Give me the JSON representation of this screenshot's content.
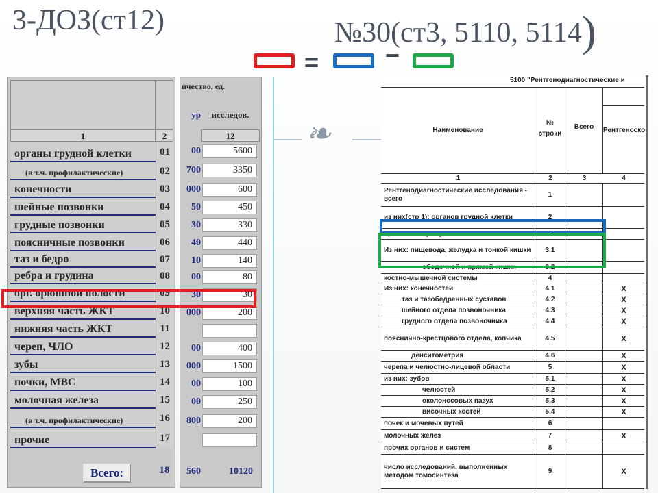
{
  "title": {
    "left": "3-ДОЗ(ст12)",
    "right": "№30(ст3, 5110, 5114",
    "right_paren": ")"
  },
  "legend": {
    "equals": "=",
    "minus": "−"
  },
  "divider_glyph": "❧",
  "colors": {
    "red": "#e02020",
    "blue": "#1a6bc0",
    "green": "#1ea84a"
  },
  "left_table": {
    "col1_header": "1",
    "col2_header": "2",
    "rows": [
      {
        "name": "органы грудной клетки",
        "code": "01",
        "small": false
      },
      {
        "name": "(в т.ч. профилактические)",
        "code": "02",
        "small": true
      },
      {
        "name": "конечности",
        "code": "03",
        "small": false
      },
      {
        "name": "шейные позвонки",
        "code": "04",
        "small": false
      },
      {
        "name": "грудные позвонки",
        "code": "05",
        "small": false
      },
      {
        "name": "поясничные позвонки",
        "code": "06",
        "small": false
      },
      {
        "name": "таз и бедро",
        "code": "07",
        "small": false
      },
      {
        "name": "ребра и грудина",
        "code": "08",
        "small": false
      },
      {
        "name": "орг. орюшной полости",
        "code": "09",
        "small": false
      },
      {
        "name": "верхняя часть ЖКТ",
        "code": "10",
        "small": false
      },
      {
        "name": "нижняя часть ЖКТ",
        "code": "11",
        "small": false
      },
      {
        "name": "череп, ЧЛО",
        "code": "12",
        "small": false
      },
      {
        "name": "зубы",
        "code": "13",
        "small": false
      },
      {
        "name": "почки, МВС",
        "code": "14",
        "small": false
      },
      {
        "name": "молочная железа",
        "code": "15",
        "small": false
      },
      {
        "name": "(в т.ч. профилактические)",
        "code": "16",
        "small": true
      },
      {
        "name": "прочие",
        "code": "17",
        "small": false
      }
    ],
    "total_label": "Всего:",
    "total_code": "18"
  },
  "mid_table": {
    "header_text": "ичество, ед.",
    "col_left_header": "ур",
    "col_right_header": "исследов.",
    "col_number": "12",
    "rows": [
      {
        "left": "00",
        "value": "5600"
      },
      {
        "left": "700",
        "value": "3350"
      },
      {
        "left": "000",
        "value": "600"
      },
      {
        "left": "50",
        "value": "450"
      },
      {
        "left": "30",
        "value": "330"
      },
      {
        "left": "40",
        "value": "440"
      },
      {
        "left": "10",
        "value": "140"
      },
      {
        "left": "00",
        "value": "80"
      },
      {
        "left": "30",
        "value": "30"
      },
      {
        "left": "000",
        "value": "200"
      },
      {
        "left": "",
        "value": ""
      },
      {
        "left": "00",
        "value": "400"
      },
      {
        "left": "000",
        "value": "1500"
      },
      {
        "left": "00",
        "value": "100"
      },
      {
        "left": "00",
        "value": "250"
      },
      {
        "left": "800",
        "value": "200"
      },
      {
        "left": "",
        "value": ""
      }
    ],
    "total_left": "560",
    "total_value": "10120"
  },
  "right_table": {
    "top_title": "5100 \"Рентгенодиагностические и",
    "header_name": "Наименование",
    "header_no": "№ строки",
    "header_all": "Всего",
    "header_xr": "Рентгеноскопий",
    "col_numbers": [
      "1",
      "2",
      "3",
      "4"
    ],
    "rows": [
      {
        "name": "Рентгенодиагностические исследования - всего",
        "no": "1",
        "xr": "",
        "ind": 0,
        "h": 34
      },
      {
        "name": "из них(стр 1): органов грудной клетки",
        "no": "2",
        "xr": "",
        "ind": 0,
        "h": 32
      },
      {
        "name": "органов пищеварения",
        "no": "3",
        "xr": "",
        "ind": 0,
        "h": 16
      },
      {
        "name": "Из них: пищевода, желудка и тонкой кишки",
        "no": "3.1",
        "xr": "",
        "ind": 0,
        "h": 32
      },
      {
        "name": "ободочной и прямой кишки",
        "no": "3.2",
        "xr": "",
        "ind": 3,
        "h": 18
      },
      {
        "name": "костно-мышечной системы",
        "no": "4",
        "xr": "",
        "ind": 0,
        "h": 14
      },
      {
        "name": "Из них: конечностей",
        "no": "4.1",
        "xr": "X",
        "ind": 0,
        "h": 16
      },
      {
        "name": "таз и тазобедренных суставов",
        "no": "4.2",
        "xr": "X",
        "ind": 1,
        "h": 16
      },
      {
        "name": "шейного отдела позвоночника",
        "no": "4.3",
        "xr": "X",
        "ind": 1,
        "h": 16
      },
      {
        "name": "грудного отдела позвоночника",
        "no": "4.4",
        "xr": "X",
        "ind": 1,
        "h": 16
      },
      {
        "name": "пояснично-крестцового отдела, копчика",
        "no": "4.5",
        "xr": "X",
        "ind": 0,
        "h": 34
      },
      {
        "name": "денситометрия",
        "no": "4.6",
        "xr": "X",
        "ind": 2,
        "h": 16
      },
      {
        "name": "черепа и челюстно-лицевой области",
        "no": "5",
        "xr": "X",
        "ind": 0,
        "h": 18
      },
      {
        "name": "из них: зубов",
        "no": "5.1",
        "xr": "X",
        "ind": 0,
        "h": 16
      },
      {
        "name": "челюстей",
        "no": "5.2",
        "xr": "X",
        "ind": 3,
        "h": 16
      },
      {
        "name": "околоносовых пазух",
        "no": "5.3",
        "xr": "X",
        "ind": 3,
        "h": 16
      },
      {
        "name": "височных костей",
        "no": "5.4",
        "xr": "X",
        "ind": 3,
        "h": 16
      },
      {
        "name": "почек и мочевых путей",
        "no": "6",
        "xr": "",
        "ind": 0,
        "h": 18
      },
      {
        "name": "молочных желез",
        "no": "7",
        "xr": "X",
        "ind": 0,
        "h": 18
      },
      {
        "name": "прочих органов и систем",
        "no": "8",
        "xr": "",
        "ind": 0,
        "h": 18
      },
      {
        "name": "число исследований, выполненных методом томосинтеза",
        "no": "9",
        "xr": "X",
        "ind": 0,
        "h": 50
      }
    ]
  }
}
